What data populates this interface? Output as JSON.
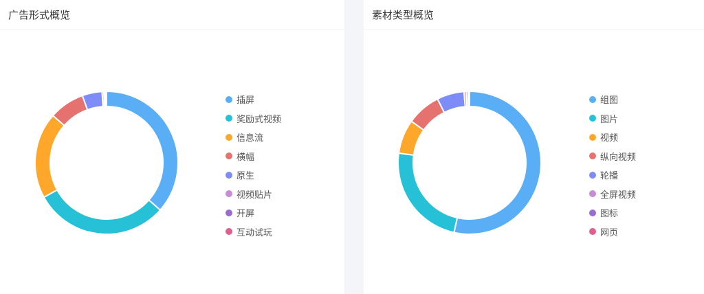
{
  "left_panel": {
    "title": "广告形式概览"
  },
  "right_panel": {
    "title": "素材类型概览"
  },
  "chart_data": [
    {
      "type": "pie",
      "donut": true,
      "legend_position": "right",
      "categories": [
        "插屏",
        "奖励式视频",
        "信息流",
        "横幅",
        "原生",
        "视频贴片",
        "开屏",
        "互动试玩"
      ],
      "values": [
        36.5,
        30.5,
        19.5,
        8,
        4.5,
        0.4,
        0.3,
        0.3
      ],
      "colors": [
        "#5aaef6",
        "#26c1d6",
        "#ffa72b",
        "#e5726f",
        "#7e8cf7",
        "#c98ad6",
        "#9a6ccf",
        "#e0608a"
      ]
    },
    {
      "type": "pie",
      "donut": true,
      "legend_position": "right",
      "categories": [
        "组图",
        "图片",
        "视频",
        "纵向视频",
        "轮播",
        "全屏视频",
        "图标",
        "网页"
      ],
      "values": [
        52,
        23,
        7.5,
        7.5,
        6,
        0.5,
        0.4,
        0.3
      ],
      "colors": [
        "#5aaef6",
        "#26c1d6",
        "#ffa72b",
        "#e5726f",
        "#7e8cf7",
        "#c98ad6",
        "#9a6ccf",
        "#e0608a"
      ]
    }
  ]
}
